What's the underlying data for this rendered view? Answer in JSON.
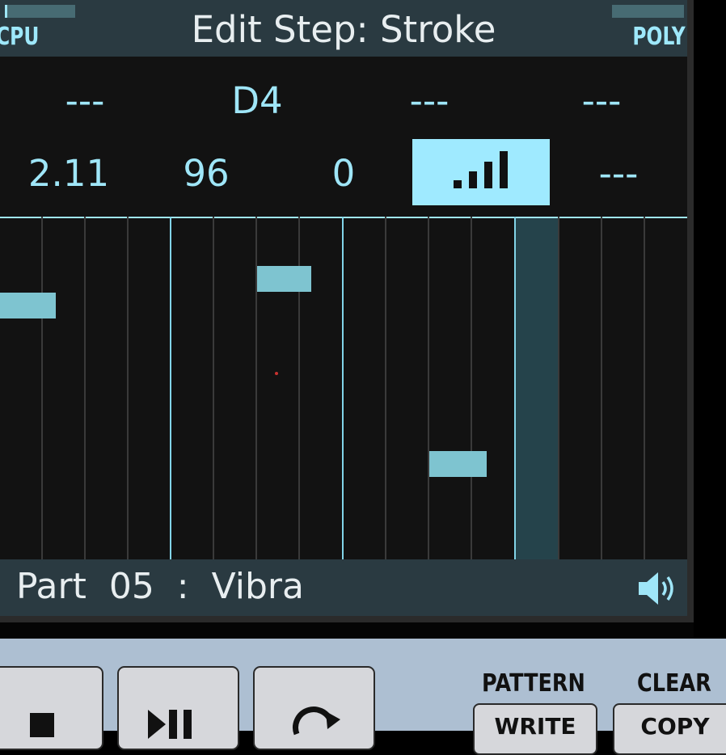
{
  "header": {
    "title": "Edit Step: Stroke",
    "cpu_label": "CPU",
    "poly_label": "POLY",
    "cpu_level": 0.04,
    "poly_level": 0.0
  },
  "params_row1": [
    "---",
    "D4",
    "---",
    "---"
  ],
  "params_row2": {
    "gate": "2.11",
    "velocity": "96",
    "offset": "0",
    "strength_icon": "signal-bars-icon",
    "last": "---"
  },
  "footer": {
    "part_label": "Part  05  :  Vibra",
    "speaker_icon": "speaker-icon"
  },
  "transport": {
    "stop_icon": "stop-icon",
    "play_pause_icon": "play-pause-icon",
    "loop_icon": "loop-icon"
  },
  "panel": {
    "pattern_label": "PATTERN",
    "clear_label": "CLEAR",
    "write_label": "WRITE",
    "copy_label": "COPY"
  },
  "colors": {
    "accent": "#9fe6f8",
    "note": "#7ec4d0",
    "header_bg": "#2a3a41",
    "playhead": "#25434b"
  }
}
